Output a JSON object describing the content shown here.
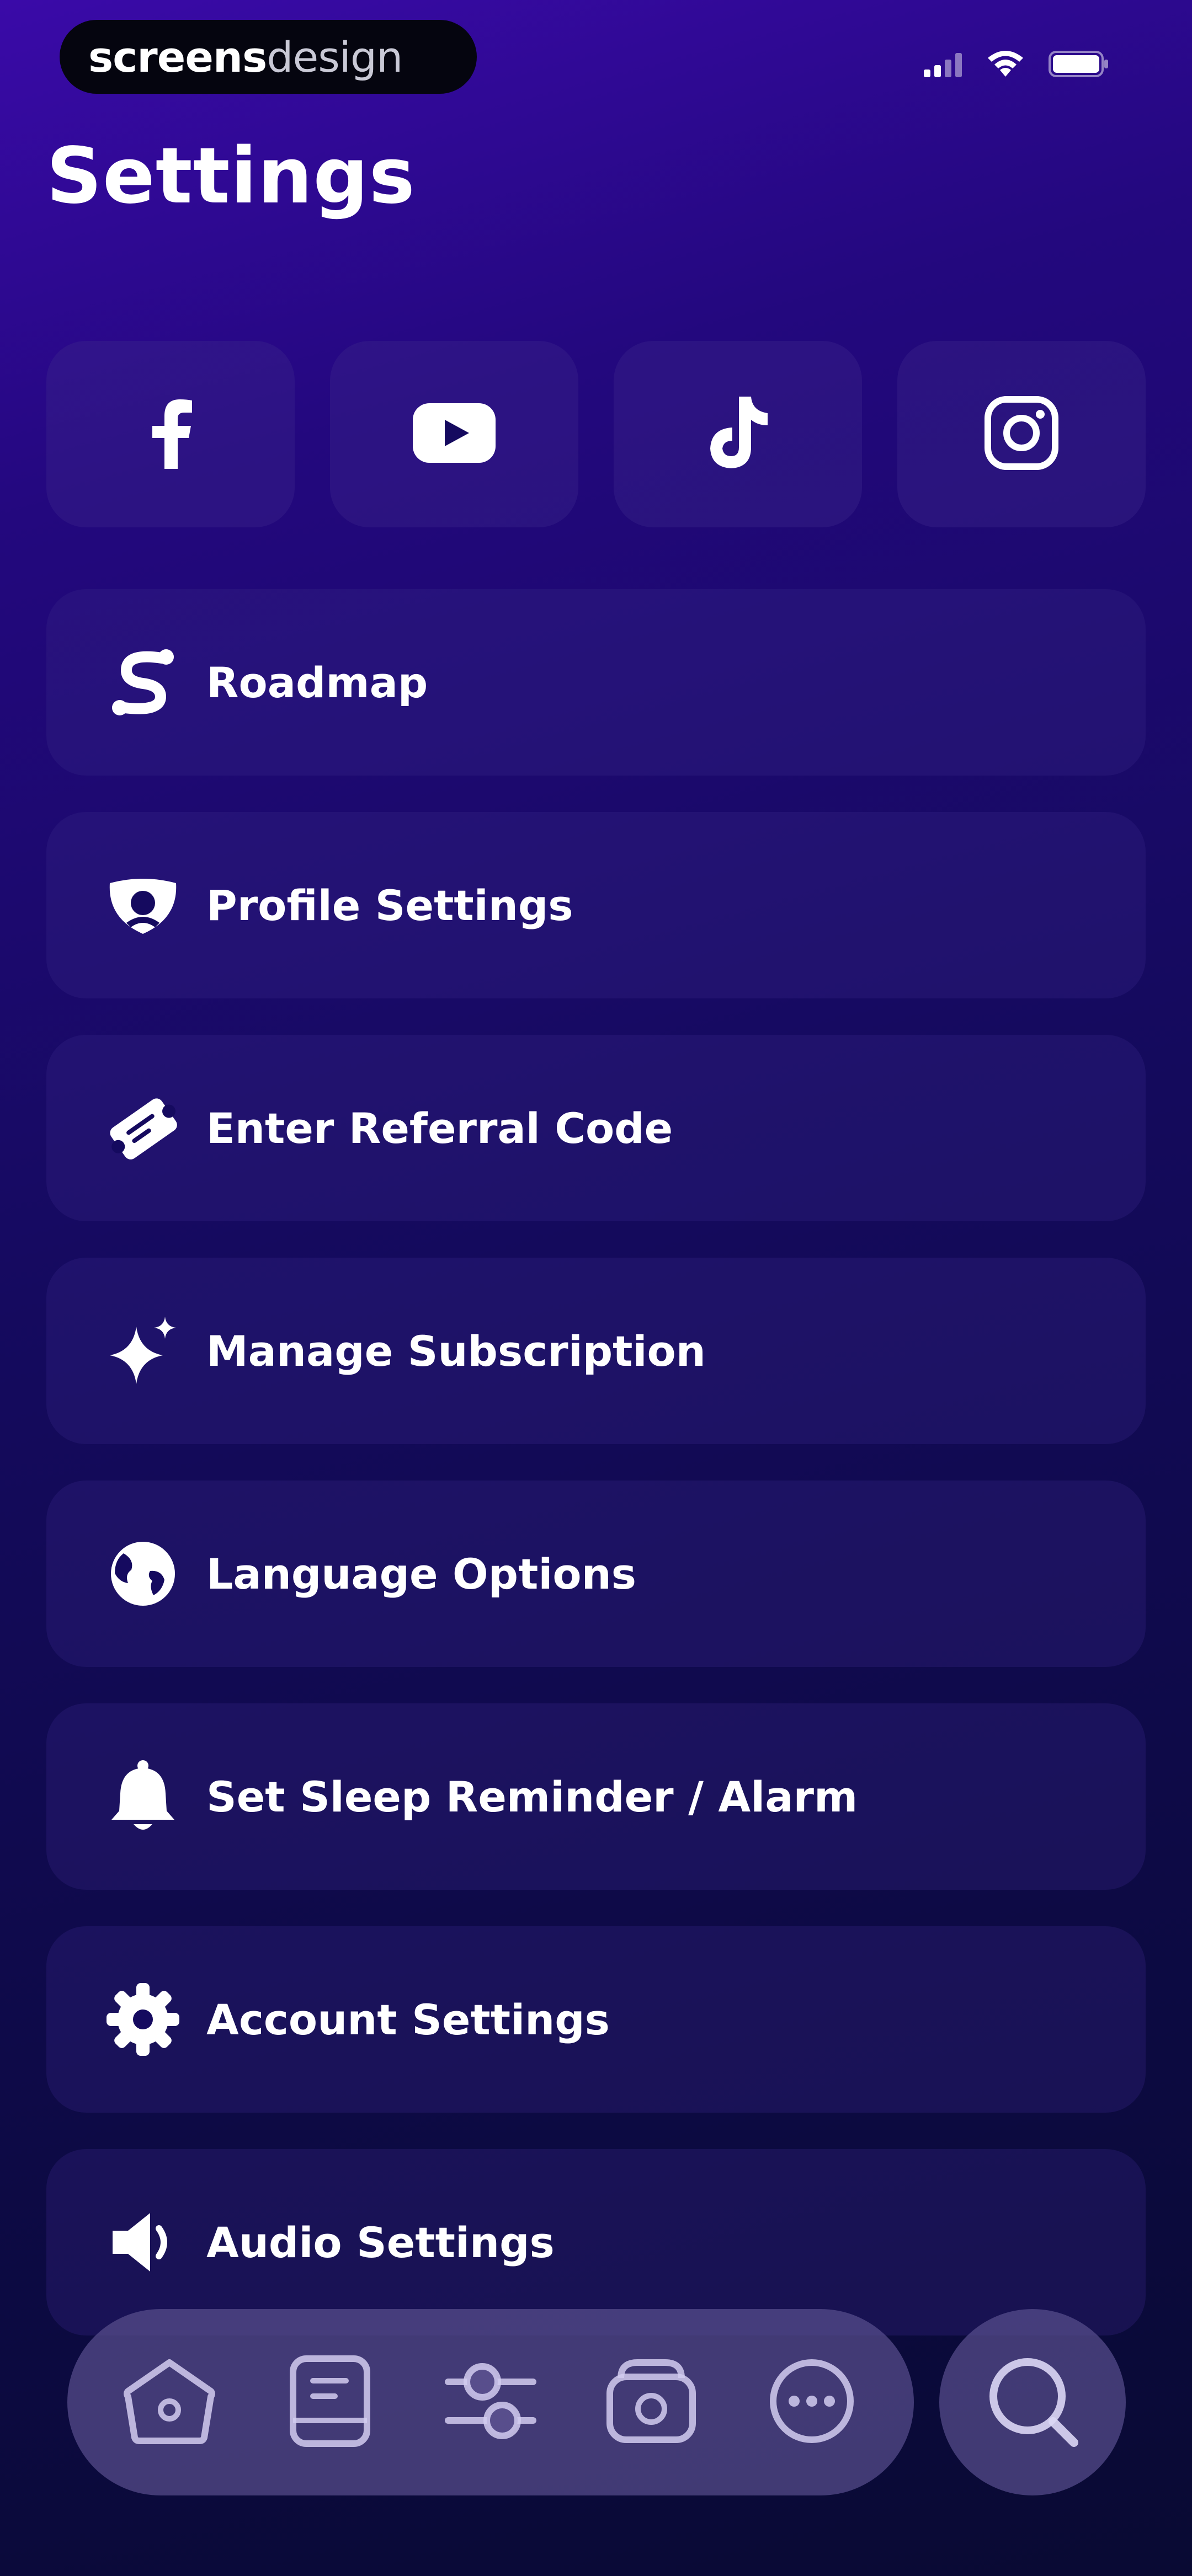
{
  "status_bar": {
    "brand_strong": "screens",
    "brand_light": "design"
  },
  "title": "Settings",
  "social": [
    {
      "icon": "facebook-icon"
    },
    {
      "icon": "youtube-icon"
    },
    {
      "icon": "tiktok-icon"
    },
    {
      "icon": "instagram-icon"
    }
  ],
  "menu": [
    {
      "label": "Roadmap",
      "icon": "roadmap-icon"
    },
    {
      "label": "Profile Settings",
      "icon": "profile-icon"
    },
    {
      "label": "Enter Referral Code",
      "icon": "referral-ticket-icon"
    },
    {
      "label": "Manage Subscription",
      "icon": "sparkle-icon"
    },
    {
      "label": "Language Options",
      "icon": "globe-icon"
    },
    {
      "label": "Set Sleep Reminder / Alarm",
      "icon": "bell-icon"
    },
    {
      "label": "Account Settings",
      "icon": "gear-icon"
    },
    {
      "label": "Audio Settings",
      "icon": "speaker-icon"
    }
  ],
  "tab_bar": [
    {
      "icon": "home-icon"
    },
    {
      "icon": "library-icon"
    },
    {
      "icon": "sliders-icon"
    },
    {
      "icon": "radio-icon"
    },
    {
      "icon": "more-icon"
    }
  ],
  "search": {
    "icon": "search-icon"
  },
  "colors": {
    "background_top": "#3a0aa8",
    "background_bottom": "#090a33",
    "tile": "#2a1f6e",
    "tab_bar": "#584e8c"
  }
}
